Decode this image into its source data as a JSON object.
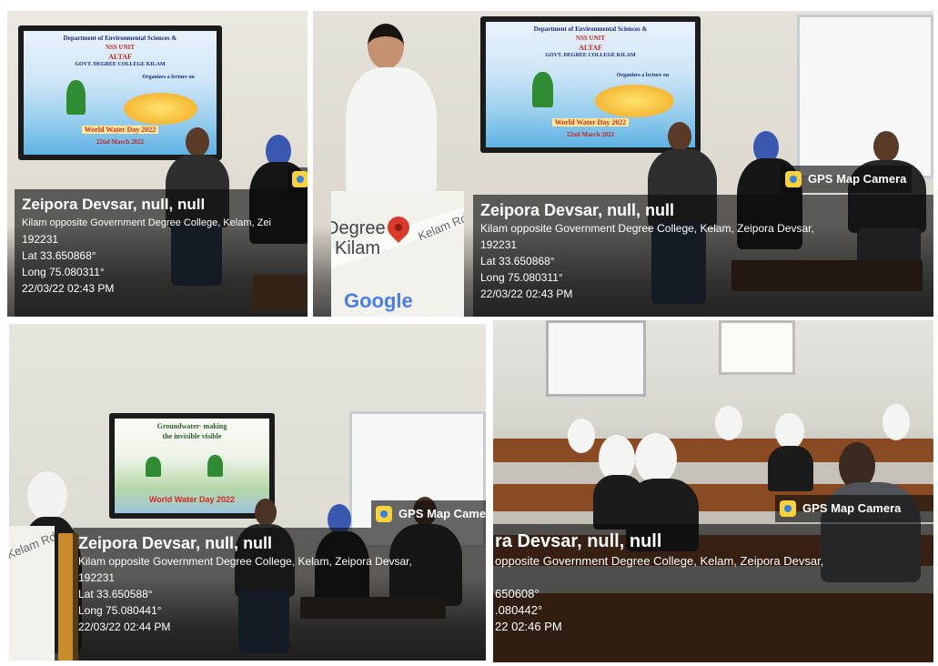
{
  "colors": {
    "overlay_bg": "#0c0c0c",
    "wall_light": "#e3e0d8",
    "wall_grey": "#c9ccc8",
    "desk_wood": "#8a4a24",
    "map_pin": "#d93a2b",
    "badge_icon": "#f7d23c"
  },
  "tiles": [
    {
      "id": "top-left",
      "overlay": {
        "title": "Zeipora Devsar, null, null",
        "line1": "Kilam opposite Government Degree College, Kelam, Zei",
        "line2": "192231",
        "lat": "Lat 33.650868°",
        "long": "Long 75.080311°",
        "datetime": "22/03/22 02:43 PM"
      },
      "tv": {
        "l1": "Department of Environmental Sciences &",
        "l2": "NSS UNIT",
        "l3": "ALTAF",
        "l4": "GOVT. DEGREE COLLEGE KILAM",
        "l5": "Organizes a lecture on",
        "l6": "World Water Day 2022",
        "l7": "22nd March 2022"
      }
    },
    {
      "id": "top-right",
      "overlay": {
        "title": "Zeipora Devsar, null, null",
        "line1": "Kilam opposite Government Degree College, Kelam, Zeipora Devsar,",
        "line2": "192231",
        "lat": "Lat 33.650868°",
        "long": "Long 75.080311°",
        "datetime": "22/03/22 02:43 PM"
      },
      "badge": "GPS Map Camera",
      "map": {
        "label1": "Degree",
        "label2": "Kilam",
        "road": "Kelam Rd",
        "logo": "Google"
      },
      "tv": {
        "l1": "Department of Environmental Sciences &",
        "l2": "NSS UNIT",
        "l3": "ALTAF",
        "l4": "GOVT. DEGREE COLLEGE KILAM",
        "l5": "Organizes a lecture on",
        "l6": "World Water Day 2022",
        "l7": "22nd March 2022"
      }
    },
    {
      "id": "bottom-left",
      "overlay": {
        "title": "Zeipora Devsar, null, null",
        "line1": "Kilam opposite Government Degree College, Kelam, Zeipora Devsar,",
        "line2": "192231",
        "lat": "Lat 33.650588°",
        "long": "Long 75.080441°",
        "datetime": "22/03/22 02:44 PM"
      },
      "badge": "GPS Map Came",
      "map": {
        "road": "Kelam Rd"
      },
      "tv": {
        "l1": "Groundwater- making",
        "l2": "the invisible visible",
        "l6": "World Water Day 2022"
      }
    },
    {
      "id": "bottom-right",
      "overlay": {
        "title": "ra Devsar, null, null",
        "line1": "opposite Government Degree College, Kelam, Zeipora Devsar,",
        "lat": "650608°",
        "long": ".080442°",
        "datetime": "22 02:46 PM"
      },
      "badge": "GPS Map Camera"
    }
  ]
}
